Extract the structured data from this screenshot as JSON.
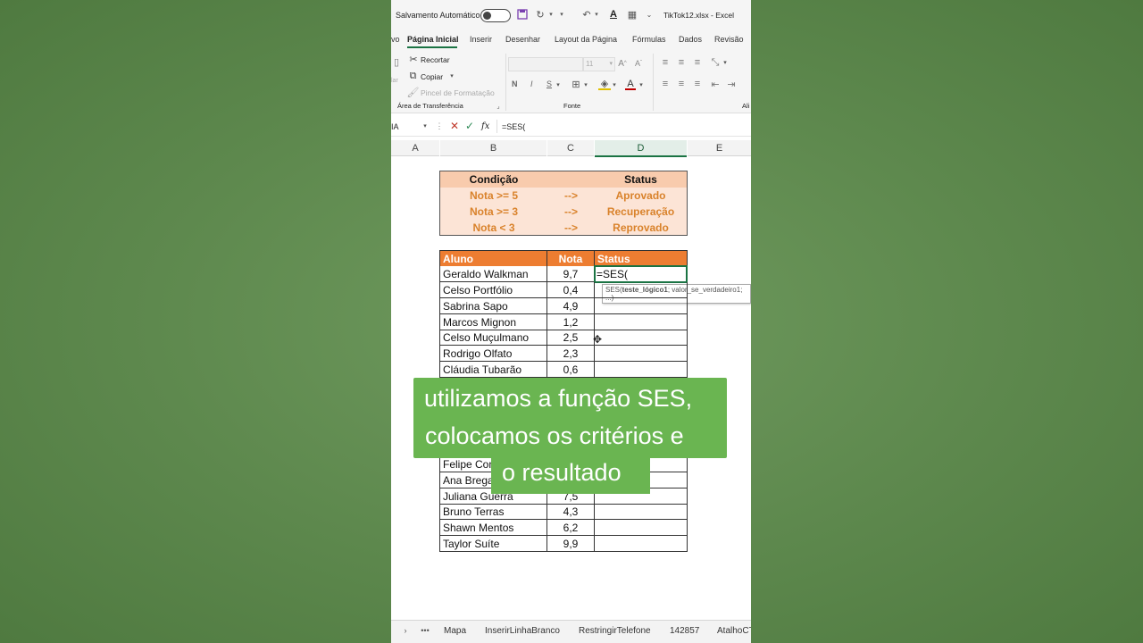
{
  "titlebar": {
    "autosave_label": "Salvamento Automático",
    "title": "TikTok12.xlsx  -  Excel"
  },
  "tabs": [
    "vo",
    "Página Inicial",
    "Inserir",
    "Desenhar",
    "Layout da Página",
    "Fórmulas",
    "Dados",
    "Revisão"
  ],
  "ribbon": {
    "cut": "Recortar",
    "copy": "Copiar",
    "format_painter": "Pincel de Formatação",
    "clipboard_group": "Área de Transferência",
    "font_size": "11",
    "bold": "N",
    "italic": "I",
    "underline": "S",
    "font_group": "Fonte",
    "align_group": "Ali",
    "left_edge": "lar"
  },
  "formula_bar": {
    "name_box": "IA",
    "fx": "fx",
    "formula": "=SES("
  },
  "columns": [
    "A",
    "B",
    "C",
    "D",
    "E"
  ],
  "criteria": {
    "header": {
      "condition": "Condição",
      "status": "Status"
    },
    "rows": [
      {
        "condition": "Nota >= 5",
        "arrow": "-->",
        "status": "Aprovado"
      },
      {
        "condition": "Nota >= 3",
        "arrow": "-->",
        "status": "Recuperação"
      },
      {
        "condition": "Nota < 3",
        "arrow": "-->",
        "status": "Reprovado"
      }
    ]
  },
  "grades": {
    "headers": {
      "student": "Aluno",
      "grade": "Nota",
      "status": "Status"
    },
    "active_cell_text": "=SES(",
    "tooltip": {
      "fn": "SES(",
      "arg1": "teste_lógico1",
      "rest": "; valor_se_verdadeiro1; ...)"
    },
    "rows_top": [
      {
        "student": "Geraldo Walkman",
        "grade": "9,7"
      },
      {
        "student": "Celso Portfólio",
        "grade": "0,4"
      },
      {
        "student": "Sabrina Sapo",
        "grade": "4,9"
      },
      {
        "student": "Marcos Mignon",
        "grade": "1,2"
      },
      {
        "student": "Celso Muçulmano",
        "grade": "2,5"
      },
      {
        "student": "Rodrigo Olfato",
        "grade": "2,3"
      },
      {
        "student": "Cláudia Tubarão",
        "grade": "0,6"
      }
    ],
    "rows_bottom": [
      {
        "student": "Felipe Con",
        "grade": ""
      },
      {
        "student": "Ana Brega",
        "grade": ""
      },
      {
        "student": "Juliana Guerra",
        "grade": "7,5"
      },
      {
        "student": "Bruno Terras",
        "grade": "4,3"
      },
      {
        "student": "Shawn Mentos",
        "grade": "6,2"
      },
      {
        "student": "Taylor Suíte",
        "grade": "9,9"
      }
    ]
  },
  "caption": {
    "line1": "utilizamos a função SES,",
    "line2": "colocamos os critérios e",
    "line3": "o resultado"
  },
  "sheets": [
    "Mapa",
    "InserirLinhaBranco",
    "RestringirTelefone",
    "142857",
    "AtalhoCT"
  ]
}
